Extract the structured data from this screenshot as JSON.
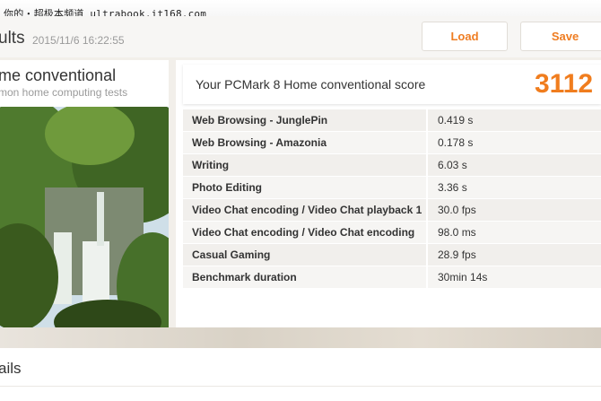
{
  "watermark": "你的・超极本频道 ultrabook.it168.com",
  "header": {
    "title": "ults",
    "date": "2015/11/6 16:22:55",
    "load_label": "Load",
    "save_label": "Save"
  },
  "benchmark": {
    "title": "me conventional",
    "subtitle": "mon home computing tests"
  },
  "score": {
    "label": "Your PCMark 8 Home conventional score",
    "value": "3112"
  },
  "results": [
    {
      "name": "Web Browsing - JunglePin",
      "value": "0.419 s"
    },
    {
      "name": "Web Browsing - Amazonia",
      "value": "0.178 s"
    },
    {
      "name": "Writing",
      "value": "6.03 s"
    },
    {
      "name": "Photo Editing",
      "value": "3.36 s"
    },
    {
      "name": "Video Chat encoding / Video Chat playback 1",
      "value": "30.0 fps"
    },
    {
      "name": "Video Chat encoding / Video Chat encoding",
      "value": "98.0 ms"
    },
    {
      "name": "Casual Gaming",
      "value": "28.9 fps"
    },
    {
      "name": "Benchmark duration",
      "value": "30min 14s"
    }
  ],
  "details": {
    "title": "ails"
  },
  "colors": {
    "accent": "#f07d1e",
    "row_odd": "#f1efec",
    "row_even": "#f6f5f3"
  }
}
